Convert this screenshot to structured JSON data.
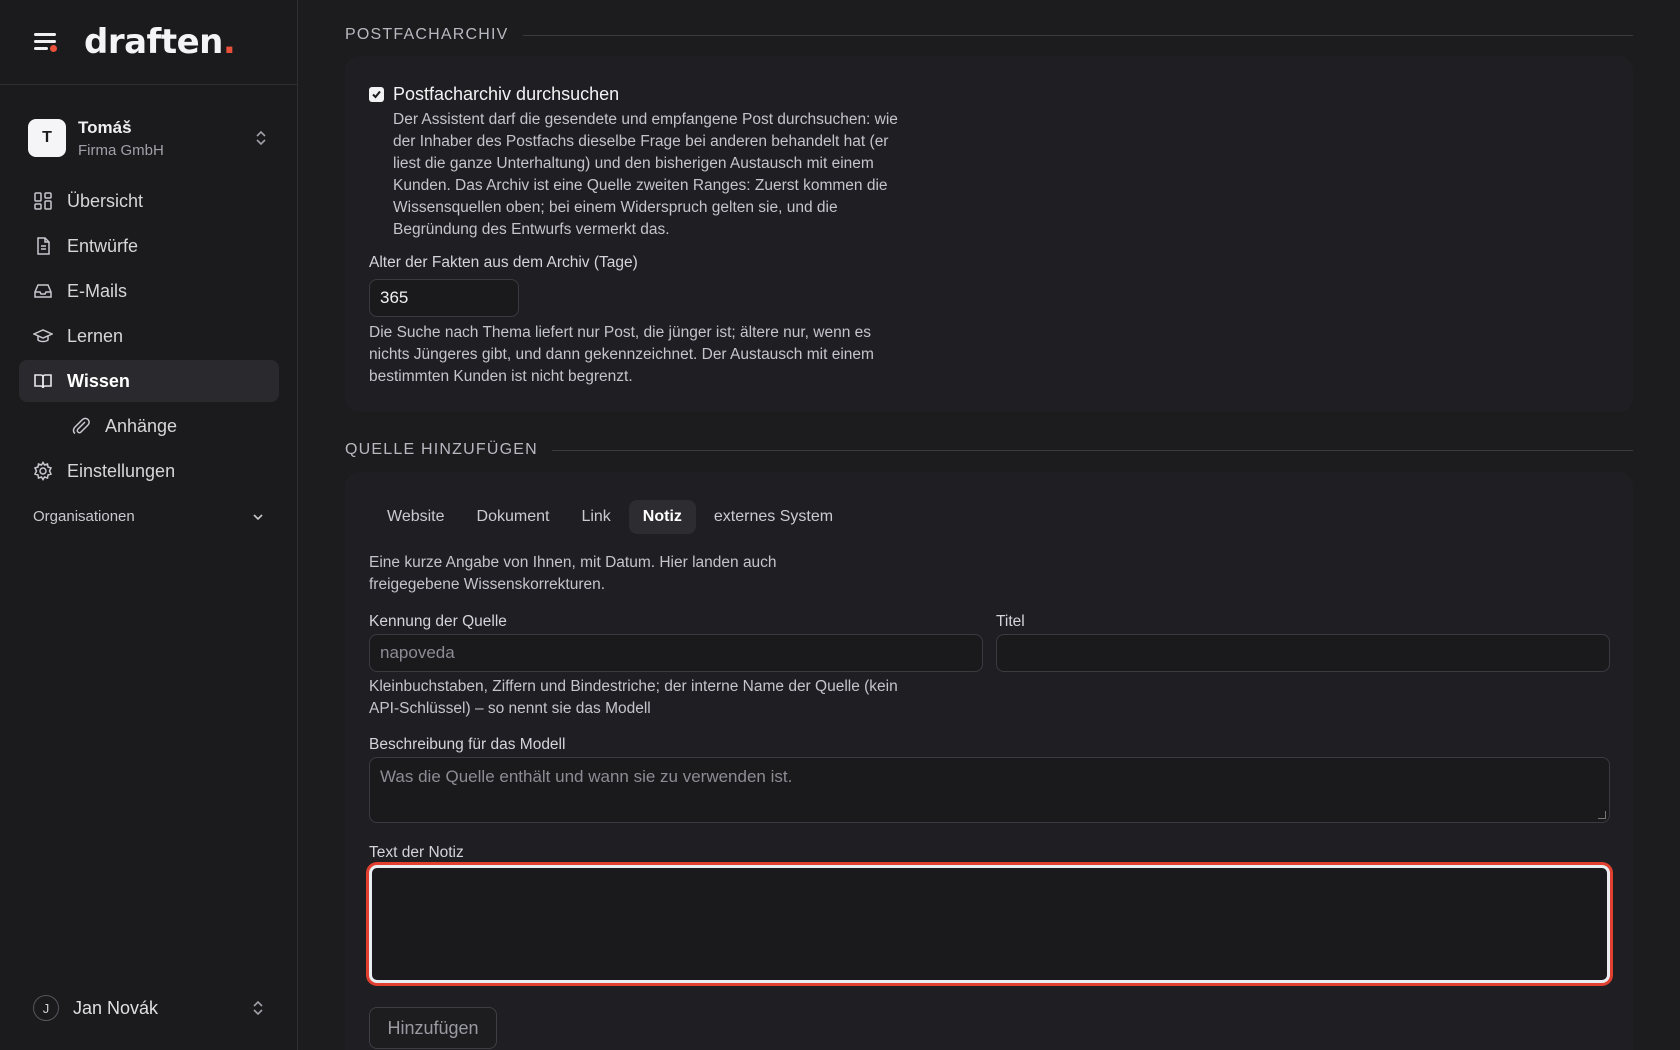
{
  "brand": {
    "name": "draften",
    "dot": "."
  },
  "org": {
    "initial": "T",
    "name": "Tomáš",
    "company": "Firma GmbH"
  },
  "nav": {
    "items": [
      {
        "label": "Übersicht",
        "icon": "grid-icon"
      },
      {
        "label": "Entwürfe",
        "icon": "document-icon"
      },
      {
        "label": "E-Mails",
        "icon": "inbox-icon"
      },
      {
        "label": "Lernen",
        "icon": "graduation-cap-icon"
      },
      {
        "label": "Wissen",
        "icon": "book-icon",
        "active": true
      },
      {
        "label": "Anhänge",
        "icon": "paperclip-icon",
        "sub": true
      },
      {
        "label": "Einstellungen",
        "icon": "gear-icon"
      }
    ],
    "section_label": "Organisationen"
  },
  "user": {
    "initial": "J",
    "name": "Jan Novák"
  },
  "archive": {
    "heading": "POSTFACHARCHIV",
    "checkbox_label": "Postfacharchiv durchsuchen",
    "checked": true,
    "description": "Der Assistent darf die gesendete und empfangene Post durchsuchen: wie der Inhaber des Postfachs dieselbe Frage bei anderen behandelt hat (er liest die ganze Unterhaltung) und den bisherigen Austausch mit einem Kunden. Das Archiv ist eine Quelle zweiten Ranges: Zuerst kommen die Wissensquellen oben; bei einem Widerspruch gelten sie, und die Begründung des Entwurfs vermerkt das.",
    "age_label": "Alter der Fakten aus dem Archiv (Tage)",
    "age_value": "365",
    "age_help": "Die Suche nach Thema liefert nur Post, die jünger ist; ältere nur, wenn es nichts Jüngeres gibt, und dann gekennzeichnet. Der Austausch mit einem bestimmten Kunden ist nicht begrenzt."
  },
  "add_source": {
    "heading": "QUELLE HINZUFÜGEN",
    "tabs": [
      {
        "label": "Website"
      },
      {
        "label": "Dokument"
      },
      {
        "label": "Link"
      },
      {
        "label": "Notiz",
        "active": true
      },
      {
        "label": "externes System"
      }
    ],
    "intro": "Eine kurze Angabe von Ihnen, mit Datum. Hier landen auch freigegebene Wissenskorrekturen.",
    "id_label": "Kennung der Quelle",
    "id_placeholder": "napoveda",
    "title_label": "Titel",
    "title_value": "",
    "id_help": "Kleinbuchstaben, Ziffern und Bindestriche; der interne Name der Quelle (kein API-Schlüssel) – so nennt sie das Modell",
    "desc_label": "Beschreibung für das Modell",
    "desc_placeholder": "Was die Quelle enthält und wann sie zu verwenden ist.",
    "note_label": "Text der Notiz",
    "note_value": "",
    "submit_label": "Hinzufügen"
  },
  "colors": {
    "accent": "#e8503a",
    "focus_ring": "#e0402f",
    "background": "#1c1c1f",
    "card": "#1f1f23"
  }
}
